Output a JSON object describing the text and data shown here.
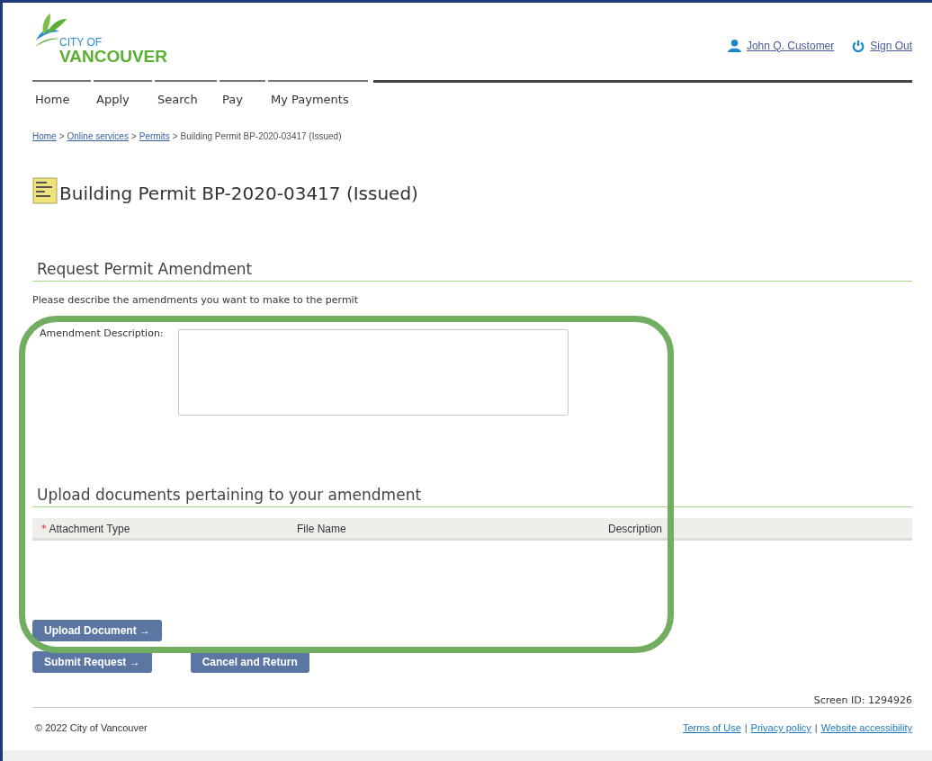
{
  "logo": {
    "line_1": "CITY OF",
    "line_2": "VANCOUVER"
  },
  "user": {
    "name": "John Q. Customer",
    "sign_out": "Sign Out"
  },
  "nav": [
    {
      "label": "Home"
    },
    {
      "label": "Apply"
    },
    {
      "label": "Search"
    },
    {
      "label": "Pay"
    },
    {
      "label": "My Payments"
    }
  ],
  "breadcrumb": {
    "separator": ">",
    "links": [
      "Home",
      "Online services",
      "Permits"
    ],
    "current": "Building Permit BP-2020-03417 (Issued)"
  },
  "page_title": "Building Permit BP-2020-03417 (Issued)",
  "amendment": {
    "heading": "Request Permit Amendment",
    "instructions": "Please describe the amendments you want to make to the permit",
    "field_label": "Amendment Description:"
  },
  "upload": {
    "heading": "Upload documents pertaining to your amendment",
    "required_mark": "*",
    "columns": [
      "Attachment Type",
      "File Name",
      "Description"
    ],
    "button": "Upload Document",
    "arrow": "→"
  },
  "buttons": [
    {
      "label": "Submit Request",
      "arrow": "→"
    },
    {
      "label": "Cancel and Return"
    }
  ],
  "screen_id": "Screen ID: 1294926",
  "footer": {
    "copyright": "© 2022 City of Vancouver",
    "separator": "|",
    "links": [
      "Terms of Use",
      "Privacy policy",
      "Website accessibility"
    ]
  },
  "annotation": {
    "color": "#72ae62"
  }
}
